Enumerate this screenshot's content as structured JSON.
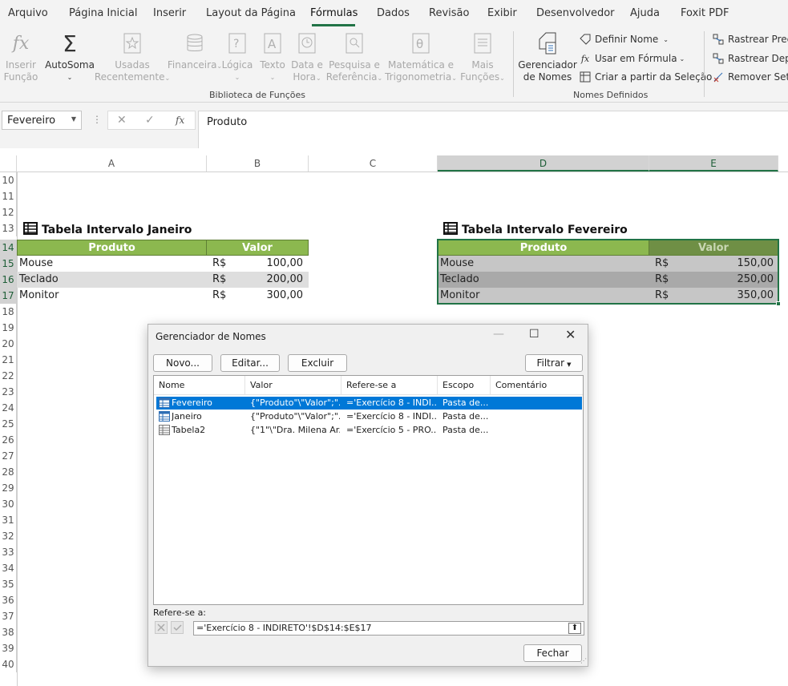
{
  "menu": {
    "tabs": [
      "Arquivo",
      "Página Inicial",
      "Inserir",
      "Layout da Página",
      "Fórmulas",
      "Dados",
      "Revisão",
      "Exibir",
      "Desenvolvedor",
      "Ajuda",
      "Foxit PDF"
    ],
    "active_tab": "Fórmulas"
  },
  "ribbon": {
    "insert_function": [
      "Inserir",
      "Função"
    ],
    "autosum": "AutoSoma",
    "recent": [
      "Usadas",
      "Recentemente"
    ],
    "financial": "Financeira",
    "logical": "Lógica",
    "text": "Texto",
    "datetime": [
      "Data e",
      "Hora"
    ],
    "lookup": [
      "Pesquisa e",
      "Referência"
    ],
    "math": [
      "Matemática e",
      "Trigonometria"
    ],
    "more": [
      "Mais",
      "Funções"
    ],
    "group_library": "Biblioteca de Funções",
    "name_manager": [
      "Gerenciador",
      "de Nomes"
    ],
    "define_name": "Definir Nome",
    "use_in_formula": "Usar em Fórmula",
    "create_from_selection": "Criar a partir da Seleção",
    "group_names": "Nomes Definidos",
    "trace_precedents": "Rastrear Prece",
    "trace_dependents": "Rastrear Depe",
    "remove_arrows": "Remover Setas",
    "chev": "⌄"
  },
  "formula_bar": {
    "name_box": "Fevereiro",
    "formula": "Produto",
    "fx": "fx"
  },
  "sheet": {
    "columns": [
      "A",
      "B",
      "C",
      "D",
      "E"
    ],
    "rows": [
      "10",
      "11",
      "12",
      "13",
      "14",
      "15",
      "16",
      "17",
      "18",
      "19",
      "20",
      "21",
      "22",
      "23",
      "24",
      "25",
      "26",
      "27",
      "28",
      "29",
      "30",
      "31",
      "32",
      "33",
      "34",
      "35",
      "36",
      "37",
      "38",
      "39",
      "40"
    ],
    "jan": {
      "title": "Tabela Intervalo Janeiro",
      "headers": [
        "Produto",
        "Valor"
      ],
      "rows": [
        {
          "produto": "Mouse",
          "cur": "R$",
          "valor": "100,00"
        },
        {
          "produto": "Teclado",
          "cur": "R$",
          "valor": "200,00"
        },
        {
          "produto": "Monitor",
          "cur": "R$",
          "valor": "300,00"
        }
      ]
    },
    "feb": {
      "title": "Tabela Intervalo Fevereiro",
      "headers": [
        "Produto",
        "Valor"
      ],
      "rows": [
        {
          "produto": "Mouse",
          "cur": "R$",
          "valor": "150,00"
        },
        {
          "produto": "Teclado",
          "cur": "R$",
          "valor": "250,00"
        },
        {
          "produto": "Monitor",
          "cur": "R$",
          "valor": "350,00"
        }
      ]
    }
  },
  "dialog": {
    "title": "Gerenciador de Nomes",
    "buttons": {
      "new": "Novo...",
      "edit": "Editar...",
      "delete": "Excluir",
      "filter": "Filtrar",
      "close": "Fechar"
    },
    "columns": [
      "Nome",
      "Valor",
      "Refere-se a",
      "Escopo",
      "Comentário"
    ],
    "names": [
      {
        "nome": "Fevereiro",
        "valor": "{\"Produto\"\\\"Valor\";\"...",
        "ref": "='Exercício 8 - INDI...",
        "escopo": "Pasta de...",
        "comentario": ""
      },
      {
        "nome": "Janeiro",
        "valor": "{\"Produto\"\\\"Valor\";\"...",
        "ref": "='Exercício 8 - INDI...",
        "escopo": "Pasta de...",
        "comentario": ""
      },
      {
        "nome": "Tabela2",
        "valor": "{\"1\"\\\"Dra. Milena Ar...",
        "ref": "='Exercício 5 - PRO...",
        "escopo": "Pasta de...",
        "comentario": ""
      }
    ],
    "refers_label": "Refere-se a:",
    "refers_value": "='Exercício 8 - INDIRETO'!$D$14:$E$17"
  },
  "colors": {
    "accent": "#217346",
    "table_header": "#8cb84f",
    "selection": "#0078d7"
  }
}
